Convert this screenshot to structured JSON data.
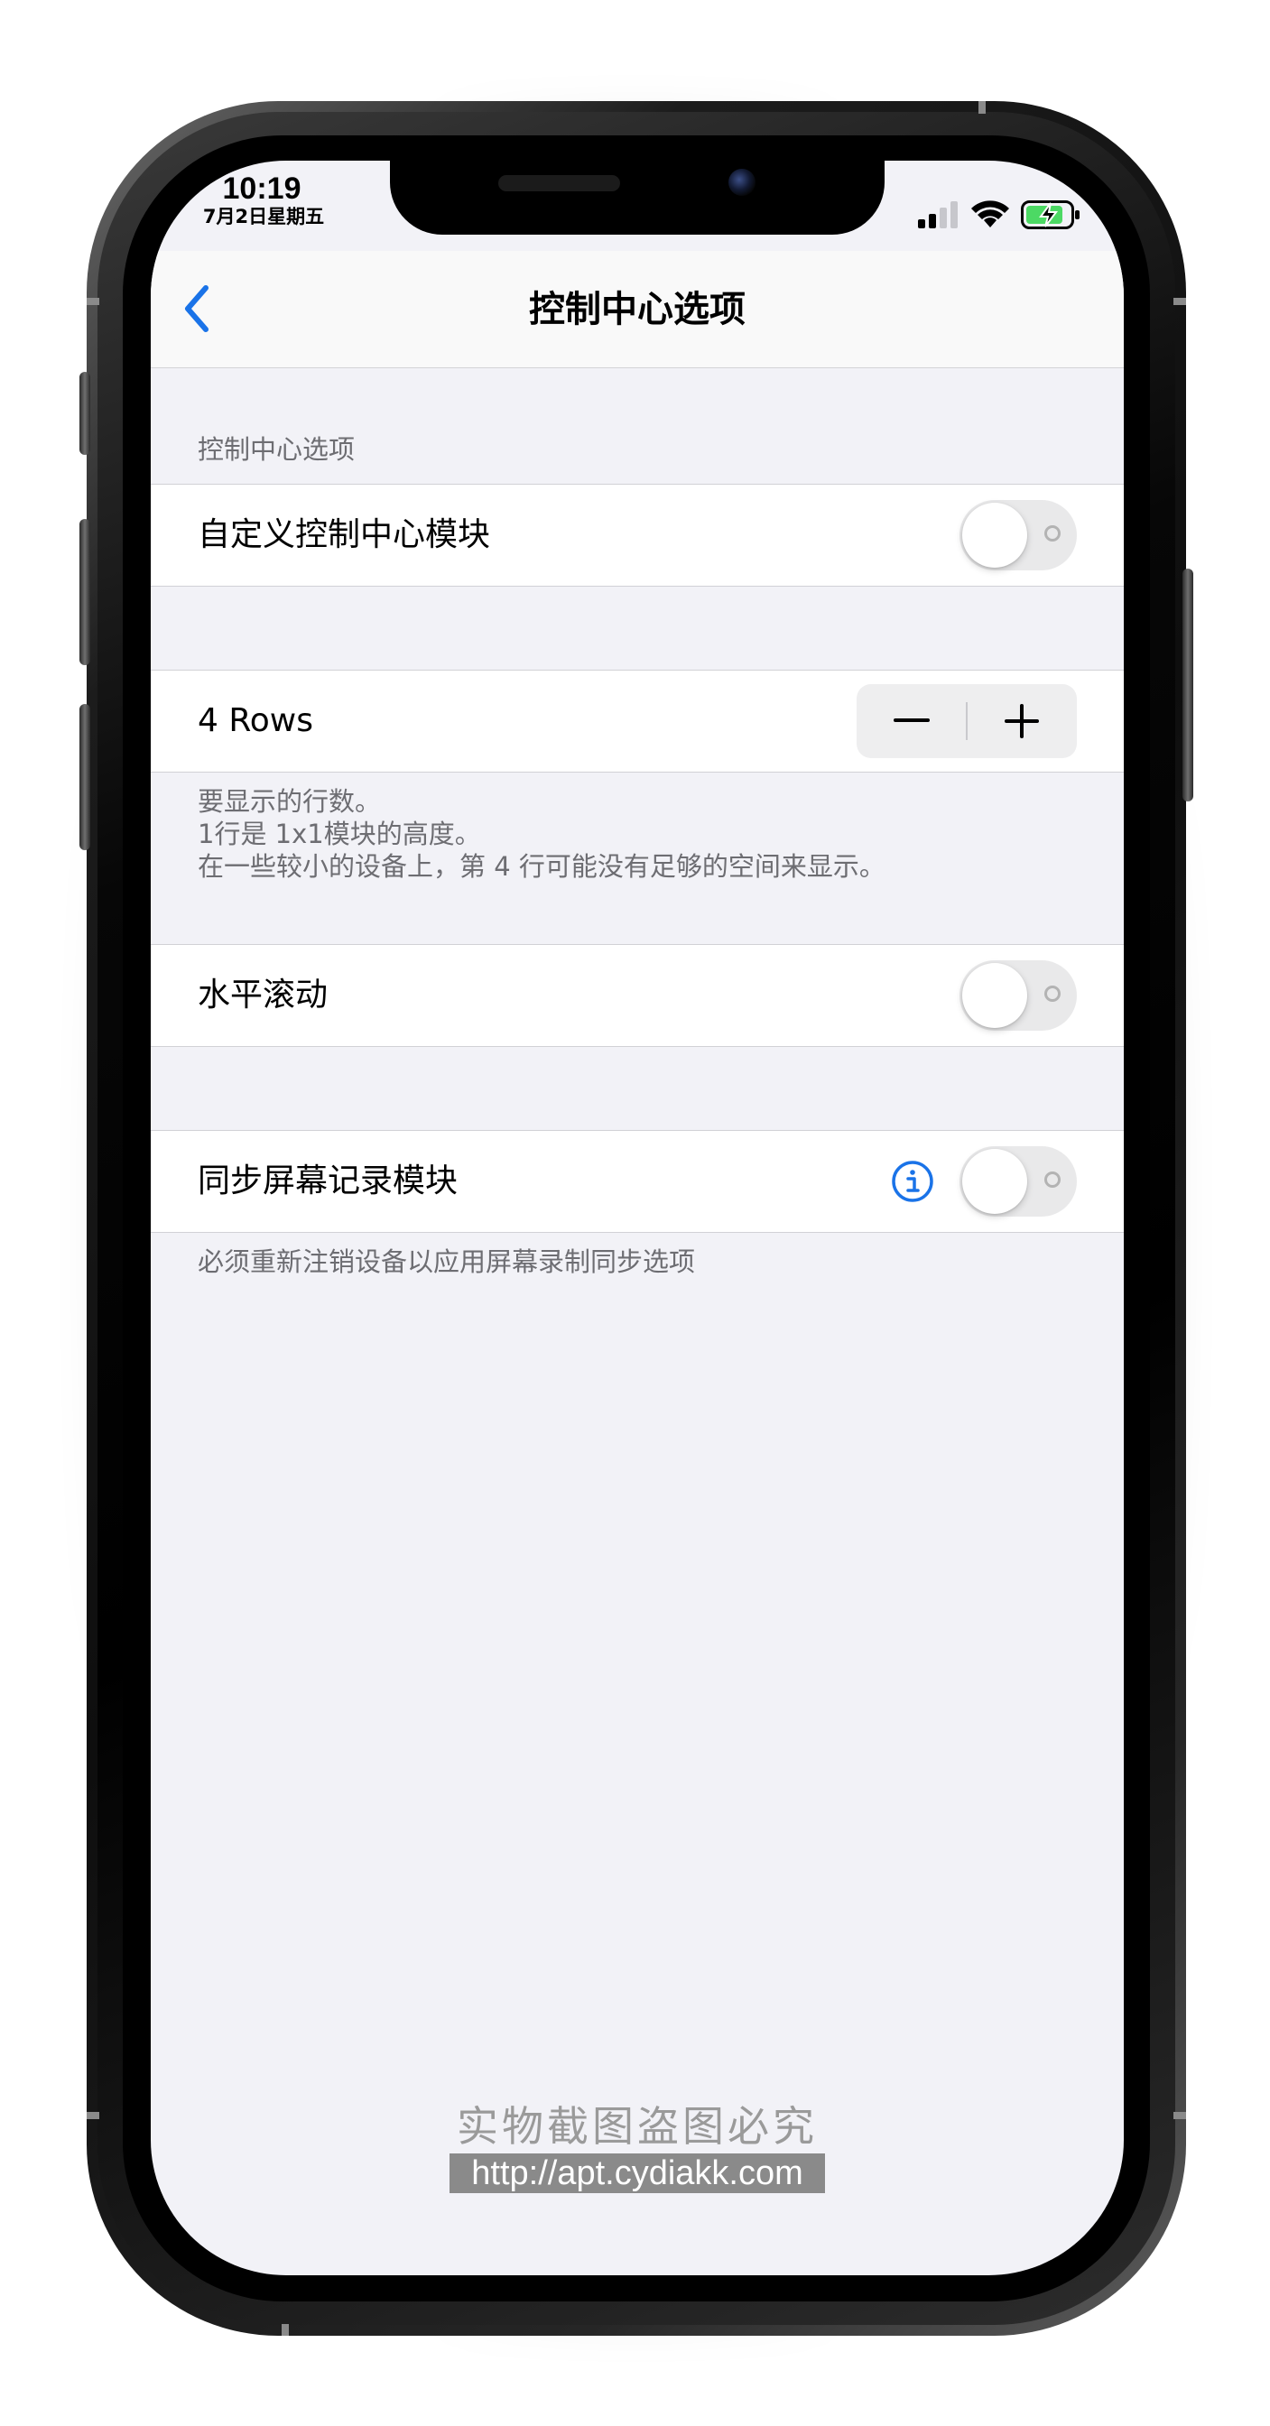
{
  "status_bar": {
    "time": "10:19",
    "date": "7月2日星期五",
    "icons": [
      "cellular-signal-icon",
      "wifi-icon",
      "battery-charging-icon"
    ],
    "battery_color": "#4cd964"
  },
  "nav": {
    "back_icon": "chevron-left-icon",
    "title": "控制中心选项",
    "accent_color": "#1a73e8"
  },
  "sections": {
    "s1": {
      "header": "控制中心选项",
      "row_label": "自定义控制中心模块",
      "toggle_on": false
    },
    "s2": {
      "row_label": "4 Rows",
      "stepper_minus": "−",
      "stepper_plus": "+",
      "footer": "要显示的行数。\n1行是 1x1模块的高度。\n在一些较小的设备上，第 4 行可能没有足够的空间来显示。"
    },
    "s3": {
      "row_label": "水平滚动",
      "toggle_on": false
    },
    "s4": {
      "row_label": "同步屏幕记录模块",
      "info_icon": "info-circle-icon",
      "toggle_on": false,
      "footer": "必须重新注销设备以应用屏幕录制同步选项"
    }
  },
  "watermark": {
    "line1": "实物截图盗图必究",
    "line2": "http://apt.cydiakk.com"
  }
}
